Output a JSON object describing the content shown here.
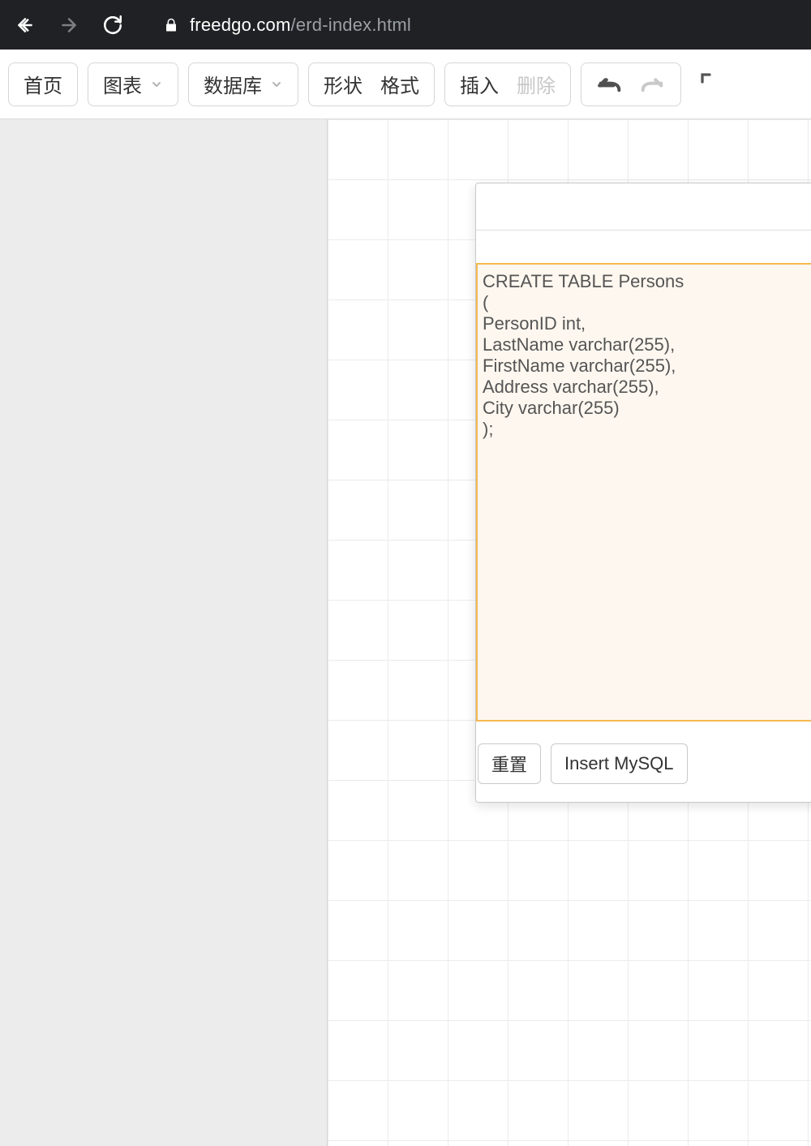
{
  "browser": {
    "url_domain": "freedgo.com",
    "url_path": "/erd-index.html"
  },
  "toolbar": {
    "home_label": "首页",
    "chart_label": "图表",
    "database_label": "数据库",
    "shape_label": "形状",
    "format_label": "格式",
    "insert_label": "插入",
    "delete_label": "删除"
  },
  "popup": {
    "sql_text": "CREATE TABLE Persons\n(\nPersonID int,\nLastName varchar(255),\nFirstName varchar(255),\nAddress varchar(255),\nCity varchar(255)\n);",
    "reset_label": "重置",
    "insert_label": "Insert MySQL"
  }
}
